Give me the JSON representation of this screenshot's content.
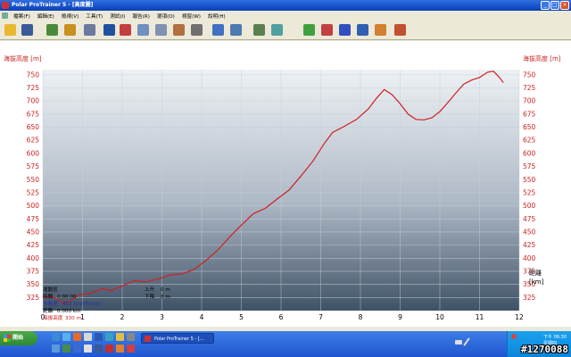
{
  "window": {
    "title": "Polar ProTrainer 5 - [高度圖]"
  },
  "menu": {
    "items": [
      "檔案(F)",
      "編輯(E)",
      "檢視(V)",
      "工具(T)",
      "測試(I)",
      "報告(R)",
      "選項(O)",
      "視窗(W)",
      "說明(H)"
    ]
  },
  "toolbar": {
    "tools": [
      {
        "name": "open-folder-icon",
        "color": "#e8b830"
      },
      {
        "name": "save-disk-icon",
        "color": "#3a5a9a"
      },
      {
        "name": "ftp-add-icon",
        "color": "#4a8a3a"
      },
      {
        "name": "medal-icon",
        "color": "#c89020"
      },
      {
        "name": "calendar-grid-icon",
        "color": "#6a7aa0"
      },
      {
        "name": "blue-book-icon",
        "color": "#2050a0"
      },
      {
        "name": "pen-icon",
        "color": "#c04040"
      },
      {
        "name": "chart-area-icon",
        "color": "#7090c0"
      },
      {
        "name": "chart-bars-icon",
        "color": "#8090b0"
      },
      {
        "name": "chart-percent-icon",
        "color": "#b07040"
      },
      {
        "name": "chart-columns-icon",
        "color": "#707070"
      },
      {
        "name": "zoom-icon",
        "color": "#4070c0"
      },
      {
        "name": "zoom-out-icon",
        "color": "#4a7ab0"
      },
      {
        "name": "hill-icon",
        "color": "#5a8050"
      },
      {
        "name": "waves-icon",
        "color": "#50a0a0"
      },
      {
        "name": "green-bars-icon",
        "color": "#40a040"
      },
      {
        "name": "red-bars-icon",
        "color": "#c04040"
      },
      {
        "name": "blue-bars-icon",
        "color": "#3050c0"
      },
      {
        "name": "graph-icon",
        "color": "#3060b0"
      },
      {
        "name": "orange-bars-icon",
        "color": "#d08030"
      },
      {
        "name": "people-icon",
        "color": "#c05030"
      }
    ]
  },
  "chart_data": {
    "type": "line",
    "ylabel": "海拔高度 [m]",
    "xlabel": "距離 [km]",
    "xlim": [
      0,
      12
    ],
    "ylim": [
      300,
      760
    ],
    "xticks": [
      0,
      1,
      2,
      3,
      4,
      5,
      6,
      7,
      8,
      9,
      10,
      11,
      12
    ],
    "yticks": [
      325,
      350,
      375,
      400,
      425,
      450,
      475,
      500,
      525,
      550,
      575,
      600,
      625,
      650,
      675,
      700,
      725,
      750
    ],
    "line_color": "#cc2020",
    "series": [
      {
        "x": [
          0,
          0.3,
          0.5,
          0.65,
          0.9,
          1.2,
          1.5,
          1.7,
          2.0,
          2.3,
          2.6,
          2.9,
          3.2,
          3.5,
          3.8,
          4.1,
          4.4,
          4.7,
          5.0,
          5.3,
          5.6,
          5.9,
          6.2,
          6.5,
          6.8,
          7.1,
          7.3,
          7.6,
          7.9,
          8.2,
          8.4,
          8.6,
          8.8,
          9.0,
          9.2,
          9.4,
          9.6,
          9.8,
          10.0,
          10.2,
          10.4,
          10.6,
          10.8,
          11.0,
          11.2,
          11.35,
          11.5,
          11.6
        ],
        "y": [
          325,
          325,
          315,
          316,
          330,
          333,
          342,
          338,
          347,
          357,
          355,
          360,
          368,
          370,
          378,
          395,
          415,
          440,
          463,
          485,
          495,
          513,
          530,
          557,
          585,
          620,
          640,
          652,
          665,
          685,
          705,
          722,
          712,
          695,
          675,
          665,
          664,
          668,
          680,
          697,
          715,
          732,
          740,
          745,
          755,
          757,
          745,
          735
        ]
      }
    ]
  },
  "stats": {
    "left": [
      {
        "label": "運動區",
        "value": ""
      },
      {
        "label": "時間",
        "value": "0:00:00"
      },
      {
        "label": "卡路里",
        "value": "452 kcal/60min"
      },
      {
        "label": "距離",
        "value": "0.000 km"
      },
      {
        "label": "海拔高度",
        "value": "330 m"
      }
    ],
    "right": [
      {
        "label": "上升",
        "value": "0 m"
      },
      {
        "label": "下降",
        "value": "0 m"
      }
    ]
  },
  "taskbar": {
    "start_label": "開始",
    "app_label": "Polar ProTrainer 5 - [...",
    "clock": "下午 06:30",
    "clock_day": "星期四"
  },
  "watermark": "#1270088"
}
